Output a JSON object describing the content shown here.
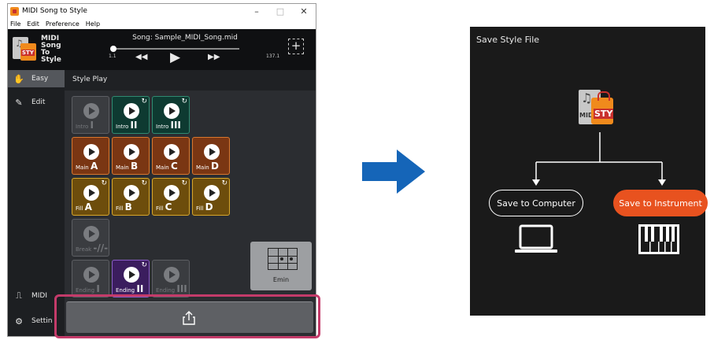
{
  "window": {
    "title": "MIDI Song to Style",
    "menu": [
      "File",
      "Edit",
      "Preference",
      "Help"
    ],
    "controls": {
      "minimize": "–",
      "maximize": "□",
      "close": "✕"
    }
  },
  "header": {
    "logo_lines": [
      "MIDI",
      "Song",
      "To",
      "Style"
    ],
    "song": "Song: Sample_MIDI_Song.mid",
    "position_start": "1.1",
    "position_end": "137.1",
    "transport": {
      "rewind": "◀◀",
      "play": "▶",
      "fast_forward": "▶▶"
    },
    "add_label": "+"
  },
  "sidebar": {
    "items": [
      {
        "label": "Easy",
        "icon": "hand-icon",
        "glyph": "✋"
      },
      {
        "label": "Edit",
        "icon": "edit-icon",
        "glyph": "✎"
      },
      {
        "label": "MIDI",
        "icon": "midi-icon",
        "glyph": "⎍"
      },
      {
        "label": "Settin",
        "icon": "gear-icon",
        "glyph": "⚙"
      }
    ]
  },
  "main": {
    "heading": "Style Play",
    "pads": {
      "intro": [
        {
          "prefix": "Intro",
          "suffix": "I",
          "state": "gray",
          "loop": false
        },
        {
          "prefix": "Intro",
          "suffix": "II",
          "state": "green",
          "loop": true
        },
        {
          "prefix": "Intro",
          "suffix": "III",
          "state": "green",
          "loop": true
        }
      ],
      "main": [
        {
          "prefix": "Main",
          "suffix": "A",
          "state": "orange",
          "loop": false
        },
        {
          "prefix": "Main",
          "suffix": "B",
          "state": "orange",
          "loop": false
        },
        {
          "prefix": "Main",
          "suffix": "C",
          "state": "orange",
          "loop": false
        },
        {
          "prefix": "Main",
          "suffix": "D",
          "state": "orange",
          "loop": false
        }
      ],
      "fill": [
        {
          "prefix": "Fill",
          "suffix": "A",
          "state": "gold",
          "loop": true
        },
        {
          "prefix": "Fill",
          "suffix": "B",
          "state": "gold",
          "loop": true
        },
        {
          "prefix": "Fill",
          "suffix": "C",
          "state": "gold",
          "loop": true
        },
        {
          "prefix": "Fill",
          "suffix": "D",
          "state": "gold",
          "loop": true
        }
      ],
      "break": [
        {
          "prefix": "Break",
          "suffix": "-//-",
          "state": "gray",
          "loop": false
        }
      ],
      "ending": [
        {
          "prefix": "Ending",
          "suffix": "I",
          "state": "gray",
          "loop": false
        },
        {
          "prefix": "Ending",
          "suffix": "II",
          "state": "purple",
          "loop": true
        },
        {
          "prefix": "Ending",
          "suffix": "III",
          "state": "gray",
          "loop": false
        }
      ]
    },
    "chord": "Emin",
    "loop_glyph": "↻",
    "export_icon": "share-export-icon"
  },
  "dialog": {
    "title": "Save Style File",
    "save_to_computer": "Save to Computer",
    "save_to_instrument": "Save to Instrument",
    "accent_color": "#e8521f",
    "arrow_color": "#1565b8"
  }
}
